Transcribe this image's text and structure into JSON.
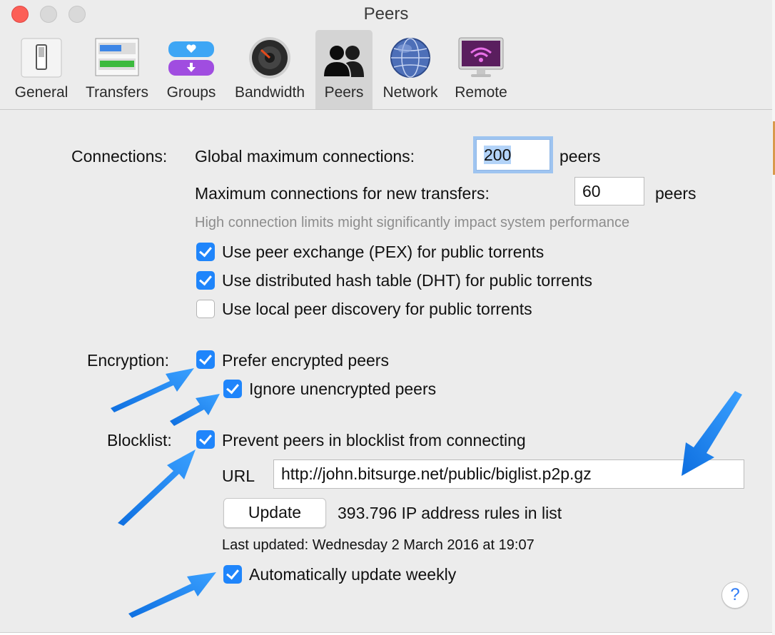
{
  "window": {
    "title": "Peers"
  },
  "toolbar": {
    "tabs": [
      {
        "label": "General",
        "icon": "switch-icon"
      },
      {
        "label": "Transfers",
        "icon": "transfers-icon"
      },
      {
        "label": "Groups",
        "icon": "groups-icon"
      },
      {
        "label": "Bandwidth",
        "icon": "speaker-icon"
      },
      {
        "label": "Peers",
        "icon": "people-icon",
        "selected": true
      },
      {
        "label": "Network",
        "icon": "globe-icon"
      },
      {
        "label": "Remote",
        "icon": "remote-monitor-icon"
      }
    ]
  },
  "connections": {
    "section_label": "Connections:",
    "global_label": "Global maximum connections:",
    "global_value": "200",
    "global_unit": "peers",
    "per_transfer_label": "Maximum connections for new transfers:",
    "per_transfer_value": "60",
    "per_transfer_unit": "peers",
    "warning": "High connection limits might significantly impact system performance",
    "pex": {
      "label": "Use peer exchange (PEX) for public torrents",
      "checked": true
    },
    "dht": {
      "label": "Use distributed hash table (DHT) for public torrents",
      "checked": true
    },
    "lpd": {
      "label": "Use local peer discovery for public torrents",
      "checked": false
    }
  },
  "encryption": {
    "section_label": "Encryption:",
    "prefer": {
      "label": "Prefer encrypted peers",
      "checked": true
    },
    "ignore": {
      "label": "Ignore unencrypted peers",
      "checked": true
    }
  },
  "blocklist": {
    "section_label": "Blocklist:",
    "prevent": {
      "label": "Prevent peers in blocklist from connecting",
      "checked": true
    },
    "url_label": "URL",
    "url_value": "http://john.bitsurge.net/public/biglist.p2p.gz",
    "update_button": "Update",
    "rules_count": "393.796 IP address rules in list",
    "last_updated": "Last updated: Wednesday 2 March 2016 at 19:07",
    "auto_update": {
      "label": "Automatically update weekly",
      "checked": true
    }
  },
  "help_button": "?",
  "colors": {
    "accent": "#1f85fb",
    "annotation_arrow": "#1e8cf5",
    "close": "#fc5f57"
  }
}
